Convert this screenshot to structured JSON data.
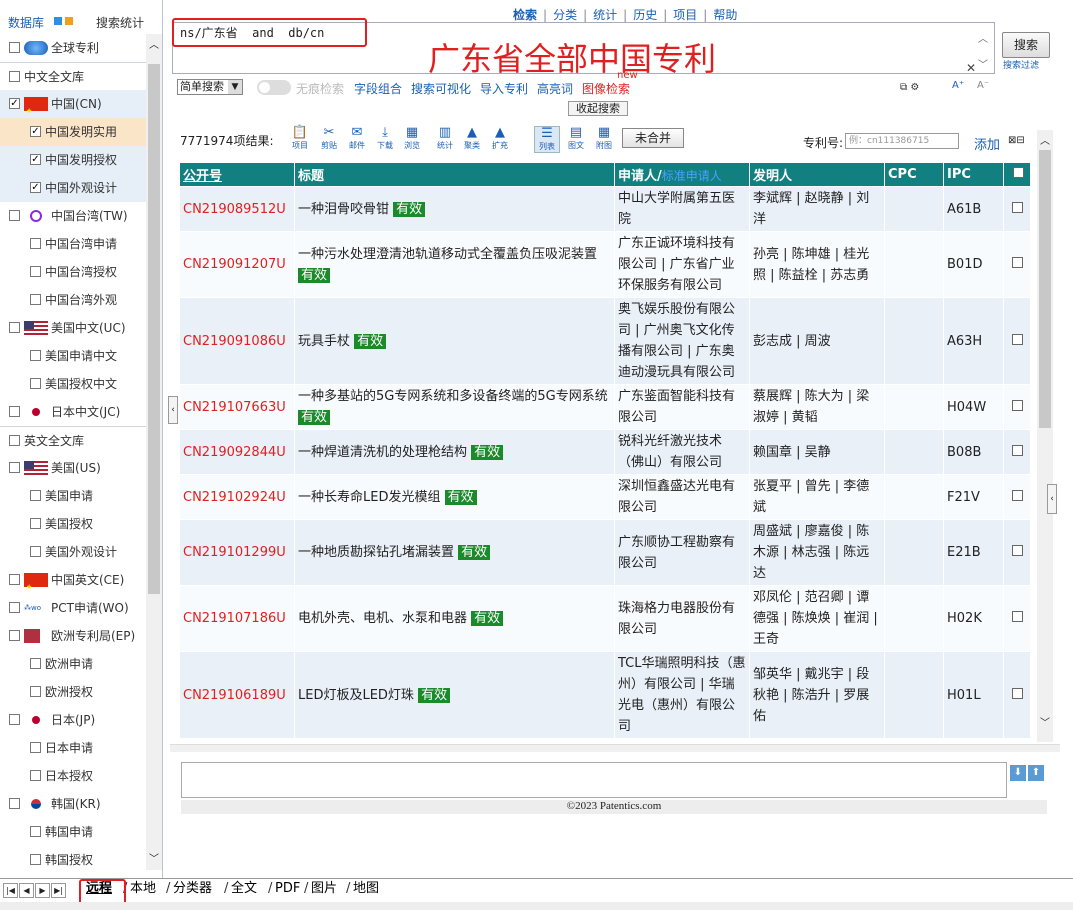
{
  "left_tabs": {
    "db": "数据库",
    "stats": "搜索统计"
  },
  "left_items": [
    {
      "label": "全球专利",
      "level": 0,
      "checked": false,
      "flag": "globe",
      "style": ""
    },
    {
      "label": "中文全文库",
      "level": 0,
      "checked": false,
      "flag": "",
      "style": "sep"
    },
    {
      "label": "中国(CN)",
      "level": 0,
      "checked": true,
      "flag": "cn",
      "style": "hlb"
    },
    {
      "label": "中国发明实用",
      "level": 1,
      "checked": true,
      "flag": "",
      "style": "hl"
    },
    {
      "label": "中国发明授权",
      "level": 1,
      "checked": true,
      "flag": "",
      "style": "hlb"
    },
    {
      "label": "中国外观设计",
      "level": 1,
      "checked": true,
      "flag": "",
      "style": "hlb"
    },
    {
      "label": "中国台湾(TW)",
      "level": 0,
      "checked": false,
      "flag": "tw",
      "style": ""
    },
    {
      "label": "中国台湾申请",
      "level": 1,
      "checked": false,
      "flag": "",
      "style": ""
    },
    {
      "label": "中国台湾授权",
      "level": 1,
      "checked": false,
      "flag": "",
      "style": ""
    },
    {
      "label": "中国台湾外观",
      "level": 1,
      "checked": false,
      "flag": "",
      "style": ""
    },
    {
      "label": "美国中文(UC)",
      "level": 0,
      "checked": false,
      "flag": "us",
      "style": ""
    },
    {
      "label": "美国申请中文",
      "level": 1,
      "checked": false,
      "flag": "",
      "style": ""
    },
    {
      "label": "美国授权中文",
      "level": 1,
      "checked": false,
      "flag": "",
      "style": ""
    },
    {
      "label": "日本中文(JC)",
      "level": 0,
      "checked": false,
      "flag": "jp",
      "style": ""
    },
    {
      "label": "英文全文库",
      "level": 0,
      "checked": false,
      "flag": "",
      "style": "sep"
    },
    {
      "label": "美国(US)",
      "level": 0,
      "checked": false,
      "flag": "us",
      "style": ""
    },
    {
      "label": "美国申请",
      "level": 1,
      "checked": false,
      "flag": "",
      "style": ""
    },
    {
      "label": "美国授权",
      "level": 1,
      "checked": false,
      "flag": "",
      "style": ""
    },
    {
      "label": "美国外观设计",
      "level": 1,
      "checked": false,
      "flag": "",
      "style": ""
    },
    {
      "label": "中国英文(CE)",
      "level": 0,
      "checked": false,
      "flag": "cn",
      "style": ""
    },
    {
      "label": "PCT申请(WO)",
      "level": 0,
      "checked": false,
      "flag": "wo",
      "style": ""
    },
    {
      "label": "欧洲专利局(EP)",
      "level": 0,
      "checked": false,
      "flag": "ep",
      "style": ""
    },
    {
      "label": "欧洲申请",
      "level": 1,
      "checked": false,
      "flag": "",
      "style": ""
    },
    {
      "label": "欧洲授权",
      "level": 1,
      "checked": false,
      "flag": "",
      "style": ""
    },
    {
      "label": "日本(JP)",
      "level": 0,
      "checked": false,
      "flag": "jp",
      "style": ""
    },
    {
      "label": "日本申请",
      "level": 1,
      "checked": false,
      "flag": "",
      "style": ""
    },
    {
      "label": "日本授权",
      "level": 1,
      "checked": false,
      "flag": "",
      "style": ""
    },
    {
      "label": "韩国(KR)",
      "level": 0,
      "checked": false,
      "flag": "kr",
      "style": ""
    },
    {
      "label": "韩国申请",
      "level": 1,
      "checked": false,
      "flag": "",
      "style": ""
    },
    {
      "label": "韩国授权",
      "level": 1,
      "checked": false,
      "flag": "",
      "style": ""
    }
  ],
  "topnav": [
    "检索",
    "分类",
    "统计",
    "历史",
    "项目",
    "帮助"
  ],
  "query": {
    "text": "ns/广东省  and  db/cn",
    "annotation": "广东省全部中国专利"
  },
  "search": {
    "button": "搜索",
    "filter": "搜索过滤",
    "clear": "✕"
  },
  "toolbar2": {
    "mode": "简单搜索",
    "toggle_label": "无痕检索",
    "links": [
      "字段组合",
      "搜索可视化",
      "导入专利",
      "高亮词",
      "图像检索"
    ],
    "new_tag": "new",
    "font_up": "A⁺",
    "font_down": "A⁻"
  },
  "fold": "收起搜索",
  "results": {
    "count": "7771974项结果:",
    "tools": [
      {
        "icon": "📋",
        "label": "项目"
      },
      {
        "icon": "✂",
        "label": "剪贴"
      },
      {
        "icon": "✉",
        "label": "邮件"
      },
      {
        "icon": "⤓",
        "label": "下载"
      },
      {
        "icon": "▦",
        "label": "浏览"
      },
      {
        "icon": "▥",
        "label": "统计"
      },
      {
        "icon": "▲",
        "label": "聚类"
      },
      {
        "icon": "▲",
        "label": "扩充"
      },
      {
        "icon": "☰",
        "label": "列表"
      },
      {
        "icon": "▤",
        "label": "图文"
      },
      {
        "icon": "▦",
        "label": "附图"
      }
    ],
    "unmerge": "未合并",
    "patno_label": "专利号:",
    "patno_placeholder": "例：cn111386715",
    "add": "添加"
  },
  "table": {
    "headers": {
      "pubno": "公开号",
      "title": "标题",
      "applicant": "申请人/",
      "std_applicant": "标准申请人",
      "inventor": "发明人",
      "cpc": "CPC",
      "ipc": "IPC"
    },
    "valid_label": "有效",
    "rows": [
      {
        "pubno": "CN219089512U",
        "title": "一种泪骨咬骨钳",
        "applicant": "中山大学附属第五医院",
        "inventor": "李斌辉 | 赵晓静 | 刘洋",
        "cpc": "",
        "ipc": "A61B"
      },
      {
        "pubno": "CN219091207U",
        "title": "一种污水处理澄清池轨道移动式全覆盖负压吸泥装置",
        "applicant": "广东正诚环境科技有限公司 | 广东省广业环保服务有限公司",
        "inventor": "孙亮 | 陈坤雄 | 桂光照 | 陈益栓 | 苏志勇",
        "cpc": "",
        "ipc": "B01D"
      },
      {
        "pubno": "CN219091086U",
        "title": "玩具手杖",
        "applicant": "奥飞娱乐股份有限公司 | 广州奥飞文化传播有限公司 | 广东奥迪动漫玩具有限公司",
        "inventor": "彭志成 | 周波",
        "cpc": "",
        "ipc": "A63H"
      },
      {
        "pubno": "CN219107663U",
        "title": "一种多基站的5G专网系统和多设备终端的5G专网系统",
        "applicant": "广东鉴面智能科技有限公司",
        "inventor": "蔡展辉 | 陈大为 | 梁淑婷 | 黄韬",
        "cpc": "",
        "ipc": "H04W"
      },
      {
        "pubno": "CN219092844U",
        "title": "一种焊道清洗机的处理枪结构",
        "applicant": "锐科光纤激光技术（佛山）有限公司",
        "inventor": "赖国章 | 吴静",
        "cpc": "",
        "ipc": "B08B"
      },
      {
        "pubno": "CN219102924U",
        "title": "一种长寿命LED发光模组",
        "applicant": "深圳恒鑫盛达光电有限公司",
        "inventor": "张夏平 | 曾先 | 李德斌",
        "cpc": "",
        "ipc": "F21V"
      },
      {
        "pubno": "CN219101299U",
        "title": "一种地质勘探钻孔堵漏装置",
        "applicant": "广东顺协工程勘察有限公司",
        "inventor": "周盛斌 | 廖嘉俊 | 陈木源 | 林志强 | 陈远达",
        "cpc": "",
        "ipc": "E21B"
      },
      {
        "pubno": "CN219107186U",
        "title": "电机外壳、电机、水泵和电器",
        "applicant": "珠海格力电器股份有限公司",
        "inventor": "邓凤伦 | 范召卿 | 谭德强 | 陈焕焕 | 崔润 | 王奇",
        "cpc": "",
        "ipc": "H02K"
      },
      {
        "pubno": "CN219106189U",
        "title": "LED灯板及LED灯珠",
        "applicant": "TCL华瑞照明科技（惠州）有限公司 | 华瑞光电（惠州）有限公司",
        "inventor": "邹英华 | 戴兆宇 | 段秋艳 | 陈浩升 | 罗展佑",
        "cpc": "",
        "ipc": "H01L"
      }
    ]
  },
  "footer": "©2023 Patentics.com",
  "bottom_tabs": [
    "远程",
    "本地",
    "分类器",
    "全文",
    "PDF",
    "图片",
    "地图"
  ]
}
